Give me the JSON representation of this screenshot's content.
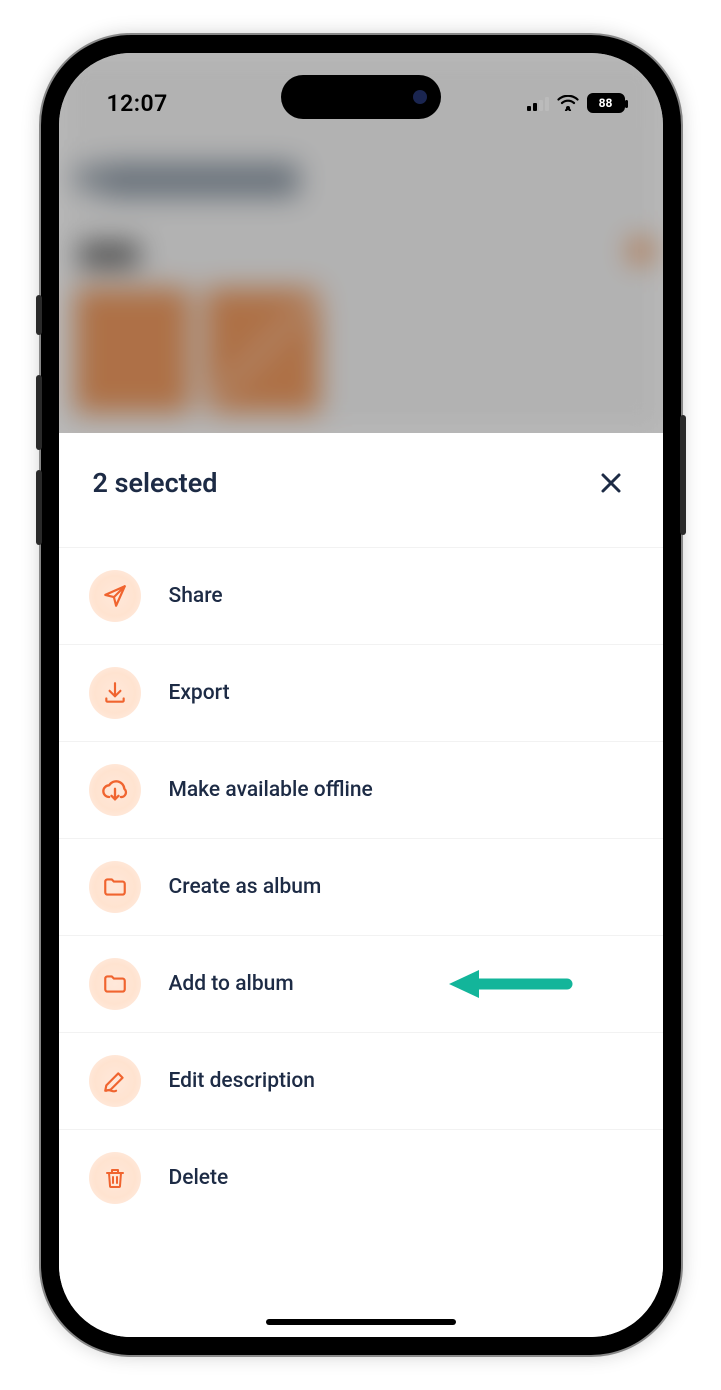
{
  "status": {
    "time": "12:07",
    "battery_pct": "88"
  },
  "sheet": {
    "title": "2 selected",
    "actions": {
      "share": "Share",
      "export": "Export",
      "offline": "Make available offline",
      "create_album": "Create as album",
      "add_album": "Add to album",
      "edit_desc": "Edit description",
      "delete": "Delete"
    }
  },
  "colors": {
    "accent": "#f0642f",
    "text": "#1d2b45",
    "annotation": "#13b59a"
  }
}
